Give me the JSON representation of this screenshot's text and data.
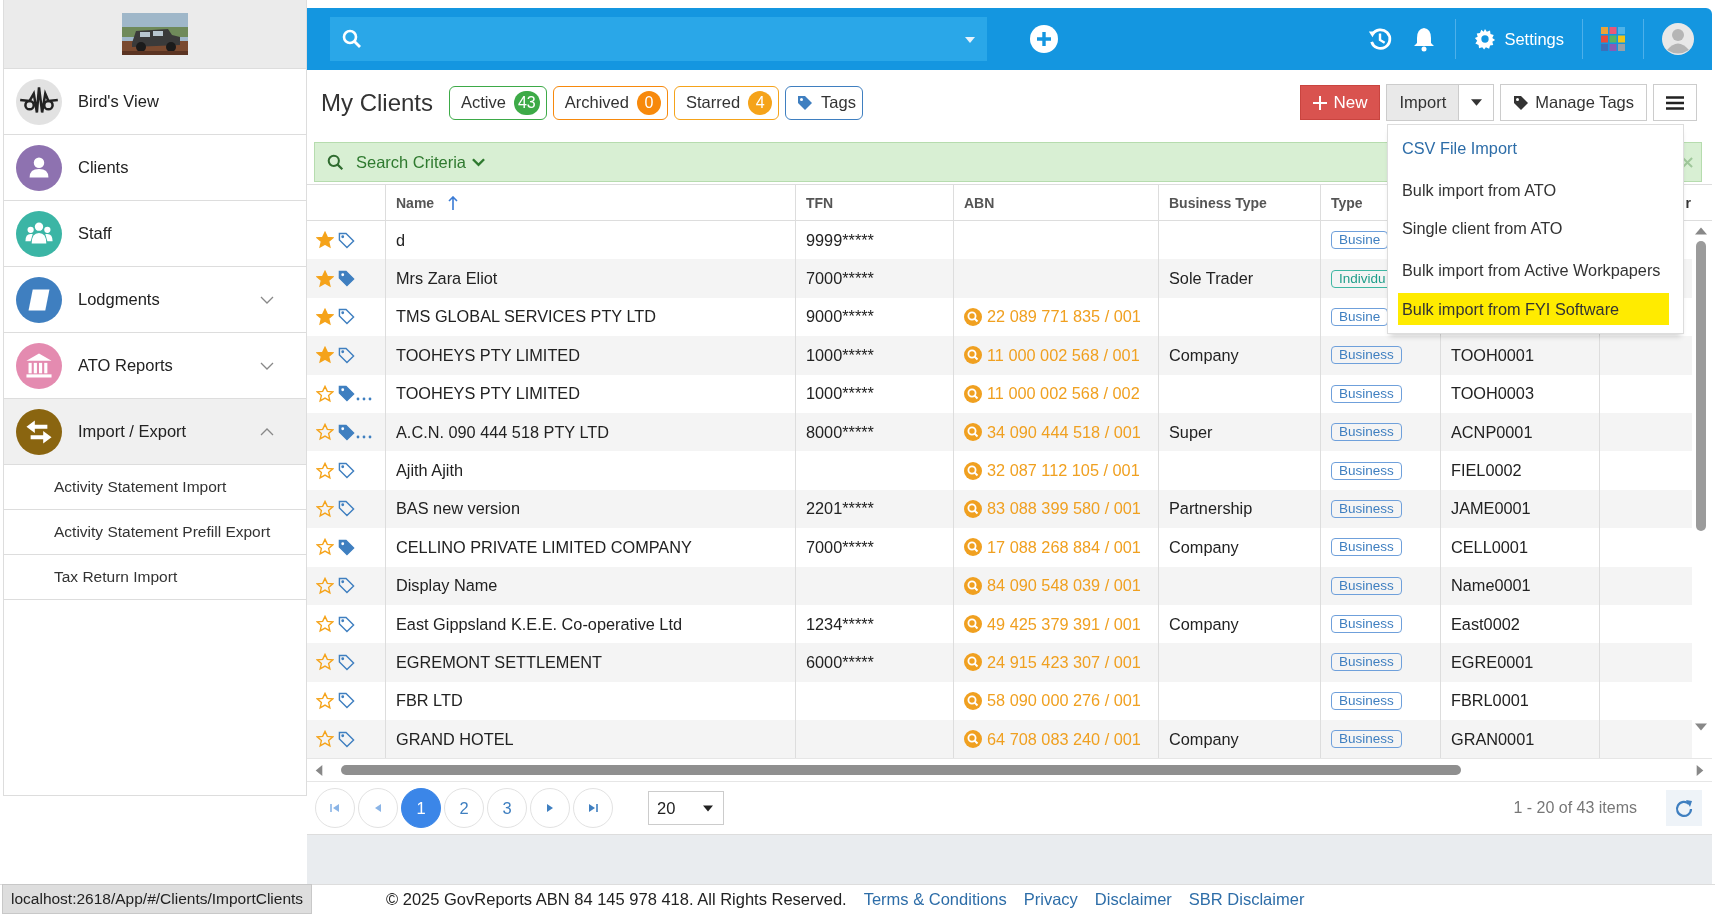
{
  "sidebar": {
    "items": [
      {
        "label": "Bird's View",
        "color": "#e2e2e2",
        "selected": false
      },
      {
        "label": "Clients",
        "color": "#8e72b0",
        "selected": false
      },
      {
        "label": "Staff",
        "color": "#3bb5a5",
        "selected": false
      },
      {
        "label": "Lodgments",
        "color": "#3f7fc0",
        "selected": false,
        "expanded": false
      },
      {
        "label": "ATO Reports",
        "color": "#e48bb0",
        "selected": false,
        "expanded": false
      },
      {
        "label": "Import / Export",
        "color": "#8a6510",
        "selected": true,
        "expanded": true,
        "children": [
          {
            "label": "Activity Statement Import"
          },
          {
            "label": "Activity Statement Prefill Export"
          },
          {
            "label": "Tax Return Import"
          }
        ]
      }
    ]
  },
  "topbar": {
    "settings_label": "Settings"
  },
  "page": {
    "title": "My Clients",
    "filters": [
      {
        "label": "Active",
        "count": "43",
        "color": "#3daa47"
      },
      {
        "label": "Archived",
        "count": "0",
        "color": "#f7890c"
      },
      {
        "label": "Starred",
        "count": "4",
        "color": "#f5a31a"
      },
      {
        "label": "Tags",
        "color": "#3f7fc0"
      }
    ],
    "new_label": "New",
    "import_label": "Import",
    "manage_tags_label": "Manage Tags"
  },
  "import_menu": [
    {
      "label": "CSV File Import",
      "kind": "link",
      "selected": false
    },
    {
      "label": "Bulk import from ATO",
      "kind": "plain",
      "selected": false
    },
    {
      "label": "Single client from ATO",
      "kind": "plain",
      "selected": false
    },
    {
      "label": "Bulk import from Active Workpapers",
      "kind": "plain",
      "selected": false
    },
    {
      "label": "Bulk import from FYI Software",
      "kind": "plain",
      "selected": true
    }
  ],
  "search_criteria": {
    "label": "Search Criteria"
  },
  "table": {
    "columns": {
      "name": {
        "label": "Name",
        "sorted": true
      },
      "tfn": "TFN",
      "abn": "ABN",
      "business_type": "Business Type",
      "type": "Type",
      "column_7": "r"
    },
    "rows": [
      {
        "starred": true,
        "tagged": false,
        "tag_more": false,
        "name": "d",
        "tfn": "9999*****",
        "type": {
          "label": "Busine",
          "kind": "business"
        }
      },
      {
        "starred": true,
        "tagged": true,
        "tag_more": false,
        "name": "Mrs Zara Eliot",
        "tfn": "7000*****",
        "business_type": "Sole Trader",
        "type": {
          "label": "Individu",
          "kind": "individual"
        }
      },
      {
        "starred": true,
        "tagged": false,
        "tag_more": false,
        "name": "TMS GLOBAL SERVICES PTY LTD",
        "tfn": "9000*****",
        "abn": "22 089 771 835 / 001",
        "type": {
          "label": "Busine",
          "kind": "business"
        }
      },
      {
        "starred": true,
        "tagged": false,
        "tag_more": false,
        "name": "TOOHEYS PTY LIMITED",
        "tfn": "1000*****",
        "abn": "11 000 002 568 / 001",
        "business_type": "Company",
        "type": {
          "label": "Business",
          "kind": "business"
        },
        "code": "TOOH0001"
      },
      {
        "starred": false,
        "tagged": true,
        "tag_more": true,
        "name": "TOOHEYS PTY LIMITED",
        "tfn": "1000*****",
        "abn": "11 000 002 568 / 002",
        "type": {
          "label": "Business",
          "kind": "business"
        },
        "code": "TOOH0003"
      },
      {
        "starred": false,
        "tagged": true,
        "tag_more": true,
        "name": "A.C.N. 090 444 518 PTY LTD",
        "tfn": "8000*****",
        "abn": "34 090 444 518 / 001",
        "business_type": "Super",
        "type": {
          "label": "Business",
          "kind": "business"
        },
        "code": "ACNP0001"
      },
      {
        "starred": false,
        "tagged": false,
        "tag_more": false,
        "name": "Ajith Ajith",
        "abn": "32 087 112 105 / 001",
        "type": {
          "label": "Business",
          "kind": "business"
        },
        "code": "FIEL0002"
      },
      {
        "starred": false,
        "tagged": false,
        "tag_more": false,
        "name": "BAS new version",
        "tfn": "2201*****",
        "abn": "83 088 399 580 / 001",
        "business_type": "Partnership",
        "type": {
          "label": "Business",
          "kind": "business"
        },
        "code": "JAME0001"
      },
      {
        "starred": false,
        "tagged": true,
        "tag_more": false,
        "name": "CELLINO PRIVATE LIMITED COMPANY",
        "tfn": "7000*****",
        "abn": "17 088 268 884 / 001",
        "business_type": "Company",
        "type": {
          "label": "Business",
          "kind": "business"
        },
        "code": "CELL0001"
      },
      {
        "starred": false,
        "tagged": false,
        "tag_more": false,
        "name": "Display Name",
        "abn": "84 090 548 039 / 001",
        "type": {
          "label": "Business",
          "kind": "business"
        },
        "code": "Name0001"
      },
      {
        "starred": false,
        "tagged": false,
        "tag_more": false,
        "name": "East Gippsland K.E.E. Co-operative Ltd",
        "tfn": "1234*****",
        "abn": "49 425 379 391 / 001",
        "business_type": "Company",
        "type": {
          "label": "Business",
          "kind": "business"
        },
        "code": "East0002"
      },
      {
        "starred": false,
        "tagged": false,
        "tag_more": false,
        "name": "EGREMONT SETTLEMENT",
        "tfn": "6000*****",
        "abn": "24 915 423 307 / 001",
        "type": {
          "label": "Business",
          "kind": "business"
        },
        "code": "EGRE0001"
      },
      {
        "starred": false,
        "tagged": false,
        "tag_more": false,
        "name": "FBR LTD",
        "abn": "58 090 000 276 / 001",
        "type": {
          "label": "Business",
          "kind": "business"
        },
        "code": "FBRL0001"
      },
      {
        "starred": false,
        "tagged": false,
        "tag_more": false,
        "name": "GRAND HOTEL",
        "abn": "64 708 083 240 / 001",
        "business_type": "Company",
        "type": {
          "label": "Business",
          "kind": "business"
        },
        "code": "GRAN0001"
      }
    ]
  },
  "pager": {
    "pages": [
      {
        "label": "1",
        "selected": true
      },
      {
        "label": "2",
        "selected": false
      },
      {
        "label": "3",
        "selected": false
      }
    ],
    "page_size": "20",
    "summary": "1 - 20 of 43 items"
  },
  "footer": {
    "copyright": "© 2025 GovReports ABN 84 145 978 418. All Rights Reserved.",
    "links": [
      "Terms & Conditions",
      "Privacy",
      "Disclaimer",
      "SBR Disclaimer"
    ]
  },
  "status_url": "localhost:2618/App/#/Clients/ImportClients"
}
